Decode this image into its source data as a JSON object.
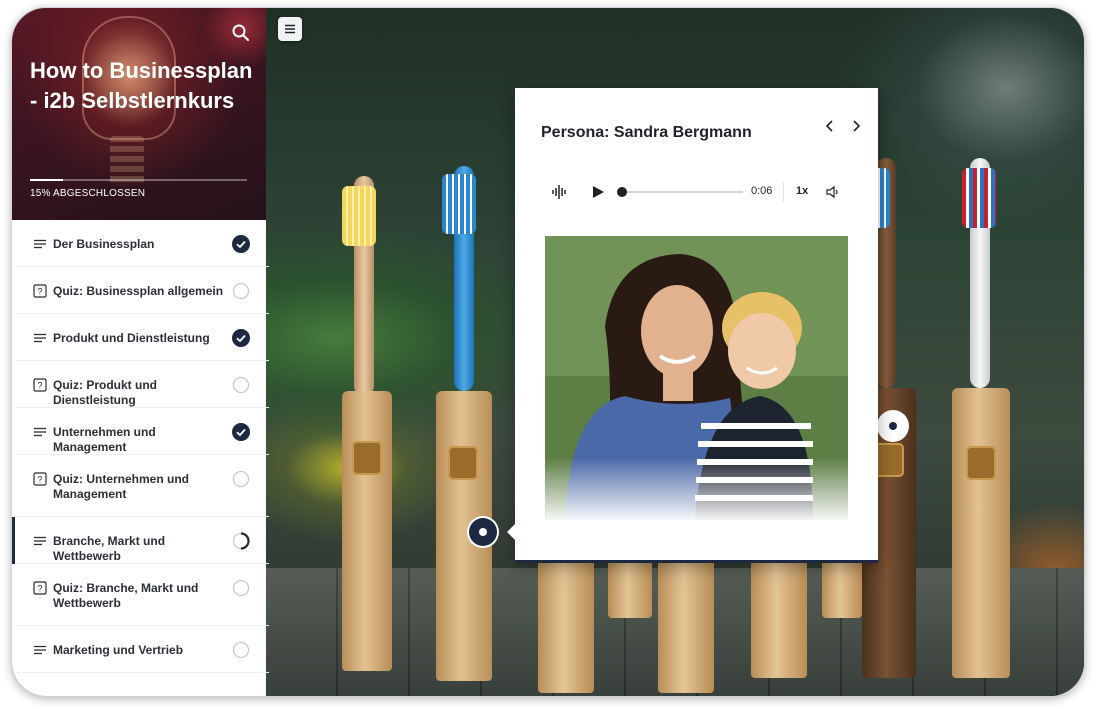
{
  "course": {
    "title": "How to Businessplan - i2b Selbstlernkurs",
    "progress_label": "15% ABGESCHLOSSEN",
    "progress_percent": 15
  },
  "lessons": [
    {
      "label": "Der Businessplan",
      "type": "lesson",
      "status": "complete"
    },
    {
      "label": "Quiz: Businessplan allgemein",
      "type": "quiz",
      "status": "incomplete"
    },
    {
      "label": "Produkt und Dienstleistung",
      "type": "lesson",
      "status": "complete"
    },
    {
      "label": "Quiz: Produkt und Dienstleistung",
      "type": "quiz",
      "status": "incomplete"
    },
    {
      "label": "Unternehmen und Management",
      "type": "lesson",
      "status": "complete"
    },
    {
      "label": "Quiz: Unternehmen und Management",
      "type": "quiz",
      "status": "incomplete"
    },
    {
      "label": "Branche, Markt und Wettbewerb",
      "type": "lesson",
      "status": "in-progress"
    },
    {
      "label": "Quiz: Branche, Markt und Wettbewerb",
      "type": "quiz",
      "status": "incomplete"
    },
    {
      "label": "Marketing und Vertrieb",
      "type": "lesson",
      "status": "incomplete"
    }
  ],
  "popup": {
    "title": "Persona: Sandra Bergmann",
    "audio": {
      "time": "0:06",
      "speed": "1x",
      "progress": 0
    }
  },
  "colors": {
    "accent": "#1c2940",
    "sidebar_header": "#3a1420",
    "card": "#ffffff"
  },
  "icons": {
    "search": "search-icon",
    "menu": "hamburger-menu-icon",
    "lesson": "lines-icon",
    "quiz": "question-box-icon",
    "complete": "check-circle-icon",
    "incomplete": "empty-circle-icon",
    "in_progress": "partial-circle-icon"
  }
}
